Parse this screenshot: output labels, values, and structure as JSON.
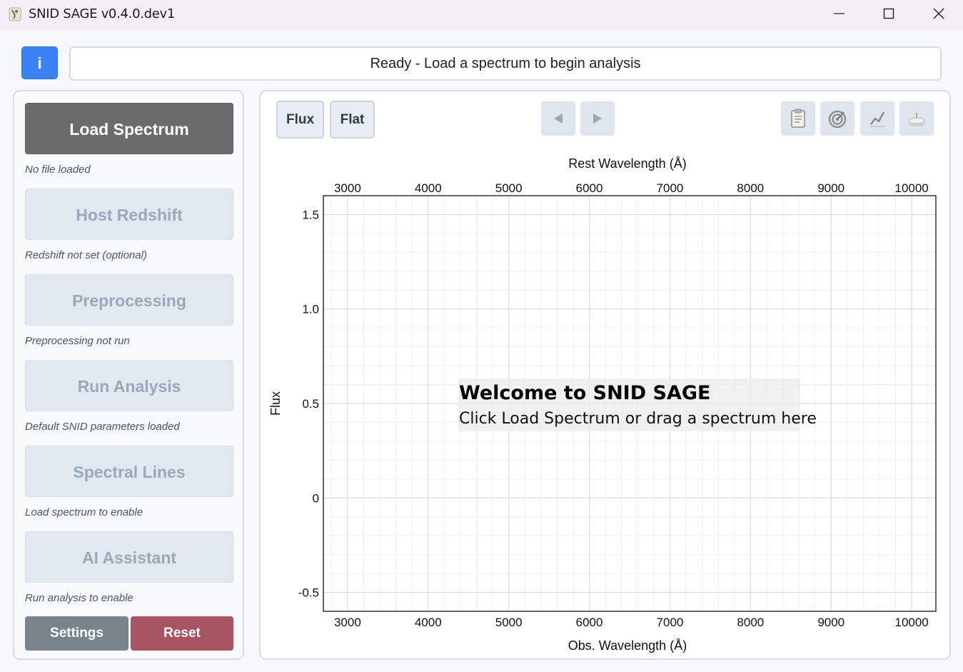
{
  "window": {
    "title": "SNID SAGE v0.4.0.dev1",
    "icon": "snid-sage-app-icon"
  },
  "header": {
    "info_label": "i",
    "status_text": "Ready - Load a spectrum to begin analysis"
  },
  "workflow": {
    "steps": [
      {
        "label": "Load Spectrum",
        "status": "No file loaded",
        "enabled": true
      },
      {
        "label": "Host Redshift",
        "status": "Redshift not set (optional)",
        "enabled": false
      },
      {
        "label": "Preprocessing",
        "status": "Preprocessing not run",
        "enabled": false
      },
      {
        "label": "Run Analysis",
        "status": "Default SNID parameters loaded",
        "enabled": false
      },
      {
        "label": "Spectral Lines",
        "status": "Load spectrum to enable",
        "enabled": false
      },
      {
        "label": "AI Assistant",
        "status": "Run analysis to enable",
        "enabled": false
      }
    ],
    "settings_label": "Settings",
    "reset_label": "Reset"
  },
  "plot_toolbar": {
    "view_flux_label": "Flux",
    "view_flat_label": "Flat",
    "prev_icon": "triangle-left-icon",
    "next_icon": "triangle-right-icon",
    "tools": [
      "clipboard-icon",
      "target-icon",
      "chart-line-icon",
      "cake-icon"
    ]
  },
  "chart_data": {
    "type": "line",
    "series": [],
    "xlabel": "Obs. Wavelength (Å)",
    "x2label": "Rest Wavelength (Å)",
    "ylabel": "Flux",
    "xlim": [
      2700,
      10300
    ],
    "ylim": [
      -0.6,
      1.6
    ],
    "x_ticks": [
      3000,
      4000,
      5000,
      6000,
      7000,
      8000,
      9000,
      10000
    ],
    "x_tick_labels": [
      "3000",
      "4000",
      "5000",
      "6000",
      "7000",
      "8000",
      "9000",
      "10000"
    ],
    "y_ticks": [
      1.5,
      1.0,
      0.5,
      0,
      -0.5
    ],
    "y_tick_labels": [
      "1.5",
      "1.0",
      "0.5",
      "0",
      "-0.5"
    ],
    "grid": true,
    "overlay_title": "Welcome to SNID SAGE",
    "overlay_subtitle": "Click Load Spectrum or drag a spectrum here"
  },
  "colors": {
    "info_button": "#3b82f6",
    "load_button": "#6b6b6b",
    "disabled_button": "#e2e8f0",
    "settings_button": "#78848a",
    "reset_button": "#a85463"
  }
}
